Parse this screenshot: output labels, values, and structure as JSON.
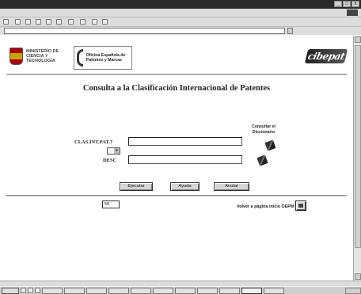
{
  "window": {
    "title": "",
    "controls": [
      "_",
      "□",
      "x"
    ]
  },
  "menu": {
    "items": []
  },
  "toolbar": {
    "items": [
      {
        "icon": "back-icon",
        "label": ""
      },
      {
        "icon": "forward-icon",
        "label": ""
      },
      {
        "icon": "stop-icon",
        "label": ""
      },
      {
        "icon": "refresh-icon",
        "label": ""
      },
      {
        "icon": "home-icon",
        "label": ""
      },
      {
        "icon": "search-icon",
        "label": ""
      },
      {
        "icon": "favorites-icon",
        "label": ""
      },
      {
        "icon": "history-icon",
        "label": ""
      },
      {
        "icon": "mail-icon",
        "label": ""
      },
      {
        "icon": "print-icon",
        "label": ""
      }
    ]
  },
  "address": {
    "label": "",
    "url": "",
    "go_label": "",
    "links_label": ""
  },
  "header": {
    "ministry_name": "MINISTERIO DE CIENCIA Y TECNOLOGÍA",
    "office_name": "Oficina Española de Patentes y Marcas",
    "brand_name": "cibepat"
  },
  "page": {
    "title": "Consulta a la Clasificación Internacional de Patentes",
    "instructions": ""
  },
  "form": {
    "dictionary_label": "Consultar el Diccionario",
    "class_label": "CLAS.INT.PAT.?",
    "class_value": "",
    "operator_value": "",
    "desc_label": "DESC",
    "desc_value": ""
  },
  "buttons": {
    "execute": "Ejecutar",
    "help": "Ayuda",
    "cancel": "Anular"
  },
  "results": {
    "label": "",
    "count": "50"
  },
  "return": {
    "label": "Volver a página inicio OEPM"
  },
  "status": {
    "left": "",
    "zone": ""
  },
  "taskbar": {
    "start_label": "",
    "tasks": [
      "",
      "",
      "",
      "",
      "",
      "",
      "",
      "",
      "",
      "",
      ""
    ],
    "clock": ""
  }
}
